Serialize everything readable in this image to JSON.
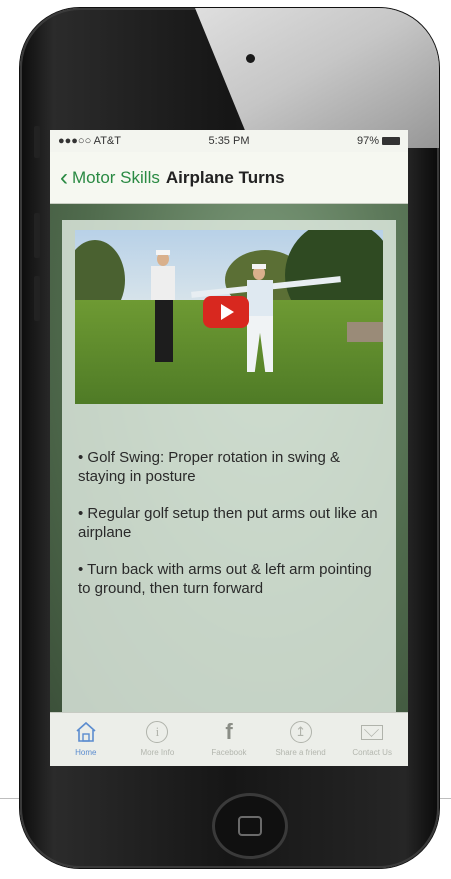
{
  "status_bar": {
    "carrier": "●●●○○ AT&T",
    "time": "5:35 PM",
    "battery": "97%"
  },
  "nav": {
    "back_label": "Motor Skills",
    "title": "Airplane Turns"
  },
  "video": {
    "play_icon": "play-icon"
  },
  "bullets": [
    "• Golf Swing: Proper rotation in swing & staying in posture",
    "• Regular golf setup then put arms out like an airplane",
    "• Turn back with arms out & left arm pointing to ground, then turn forward"
  ],
  "tabs": [
    {
      "label": "Home",
      "icon": "home-icon"
    },
    {
      "label": "More Info",
      "icon": "info-icon"
    },
    {
      "label": "Facebook",
      "icon": "facebook-icon"
    },
    {
      "label": "Share a friend",
      "icon": "share-icon"
    },
    {
      "label": "Contact Us",
      "icon": "mail-icon"
    }
  ],
  "colors": {
    "accent_green": "#2a8a43",
    "active_tab_blue": "#5b8ccf",
    "play_red": "#d8281f"
  }
}
